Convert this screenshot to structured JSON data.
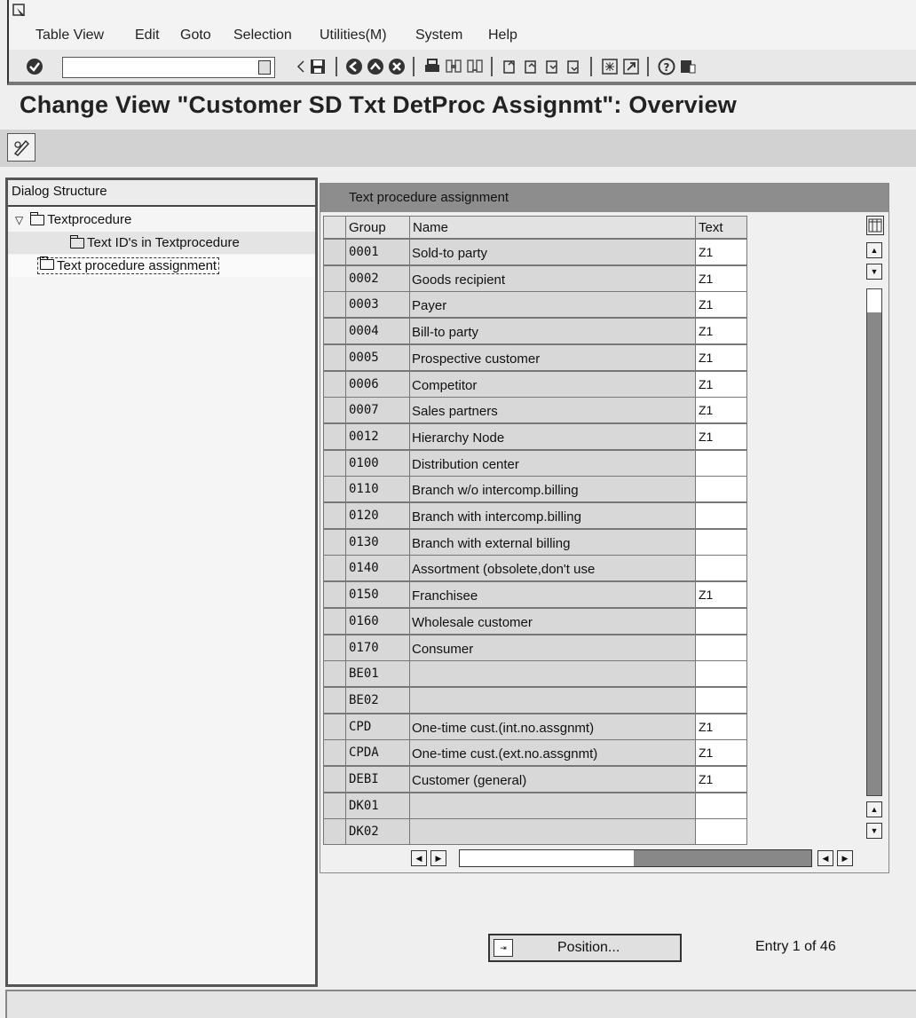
{
  "menu": {
    "items": [
      "Table View",
      "Edit",
      "Goto",
      "Selection",
      "Utilities(M)",
      "System",
      "Help"
    ]
  },
  "toolbar": {
    "command_value": "",
    "icons": [
      "enter-icon",
      "command-field",
      "back-icon",
      "save-icon",
      "back-arrow-icon",
      "exit-icon",
      "cancel-icon",
      "print-icon",
      "find-icon",
      "find-next-icon",
      "first-page-icon",
      "previous-page-icon",
      "next-page-icon",
      "last-page-icon",
      "create-session-icon",
      "shortcut-icon",
      "help-icon",
      "customize-layout-icon"
    ]
  },
  "title": "Change View \"Customer SD Txt DetProc Assignmt\": Overview",
  "dialog_structure": {
    "header": "Dialog Structure",
    "items": [
      {
        "label": "Textprocedure",
        "level": 0,
        "expanded": true
      },
      {
        "label": "Text ID's in Textprocedure",
        "level": 1
      },
      {
        "label": "Text procedure assignment",
        "level": 0,
        "selected": true
      }
    ]
  },
  "table": {
    "title": "Text procedure assignment",
    "columns": [
      "Group",
      "Name",
      "Text"
    ],
    "rows": [
      {
        "group": "0001",
        "name": "Sold-to party",
        "text": "Z1"
      },
      {
        "group": "0002",
        "name": "Goods recipient",
        "text": "Z1"
      },
      {
        "group": "0003",
        "name": "Payer",
        "text": "Z1"
      },
      {
        "group": "0004",
        "name": "Bill-to party",
        "text": "Z1"
      },
      {
        "group": "0005",
        "name": "Prospective customer",
        "text": "Z1"
      },
      {
        "group": "0006",
        "name": "Competitor",
        "text": "Z1"
      },
      {
        "group": "0007",
        "name": "Sales partners",
        "text": "Z1"
      },
      {
        "group": "0012",
        "name": "Hierarchy Node",
        "text": "Z1"
      },
      {
        "group": "0100",
        "name": "Distribution center",
        "text": ""
      },
      {
        "group": "0110",
        "name": "Branch w/o intercomp.billing",
        "text": ""
      },
      {
        "group": "0120",
        "name": "Branch with intercomp.billing",
        "text": ""
      },
      {
        "group": "0130",
        "name": "Branch with external billing",
        "text": ""
      },
      {
        "group": "0140",
        "name": "Assortment (obsolete,don't use",
        "text": ""
      },
      {
        "group": "0150",
        "name": "Franchisee",
        "text": "Z1"
      },
      {
        "group": "0160",
        "name": "Wholesale customer",
        "text": ""
      },
      {
        "group": "0170",
        "name": "Consumer",
        "text": ""
      },
      {
        "group": "BE01",
        "name": "",
        "text": ""
      },
      {
        "group": "BE02",
        "name": "",
        "text": ""
      },
      {
        "group": "CPD",
        "name": "One-time cust.(int.no.assgnmt)",
        "text": "Z1"
      },
      {
        "group": "CPDA",
        "name": "One-time cust.(ext.no.assgnmt)",
        "text": "Z1"
      },
      {
        "group": "DEBI",
        "name": "Customer (general)",
        "text": "Z1"
      },
      {
        "group": "DK01",
        "name": "",
        "text": ""
      },
      {
        "group": "DK02",
        "name": "",
        "text": ""
      }
    ]
  },
  "position_button": "Position...",
  "entry_info": "Entry 1 of 46"
}
